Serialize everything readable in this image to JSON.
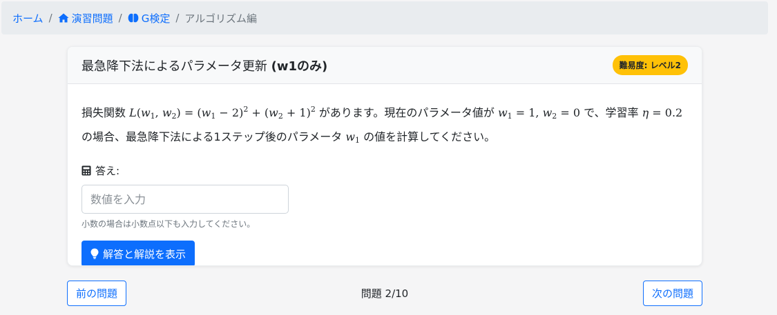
{
  "breadcrumb": {
    "home": "ホーム",
    "exercises": "演習問題",
    "exercises_icon": "home-icon",
    "gkentei": "G検定",
    "gkentei_icon": "brain-icon",
    "current": "アルゴリズム編",
    "separator": "/"
  },
  "card": {
    "title_prefix": "最急降下法によるパラメータ更新 ",
    "title_bold": "(w1のみ)",
    "badge": "難易度: レベル2",
    "question": {
      "t1": "損失関数 ",
      "t2": " があります。現在のパラメータ値が ",
      "t3": " で、学習率 ",
      "t4": " の場合、最急降下法による1ステップ後のパラメータ ",
      "t5": " の値を計算してください。"
    },
    "answer_label": "答え:",
    "answer_placeholder": "数値を入力",
    "hint": "小数の場合は小数点以下も入力してください。",
    "show_button": "解答と解説を表示"
  },
  "nav": {
    "prev": "前の問題",
    "counter": "問題 2/10",
    "next": "次の問題"
  },
  "colors": {
    "primary": "#0d6efd",
    "badge": "#ffc107",
    "breadcrumb_bg": "#e9ecef"
  }
}
